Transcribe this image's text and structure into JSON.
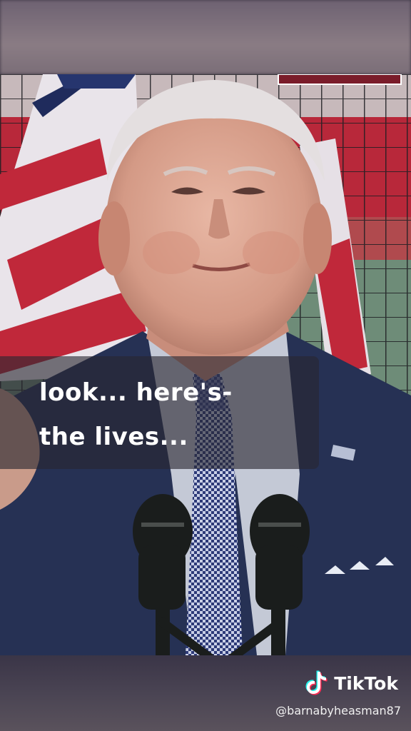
{
  "caption": {
    "line1": "look...  here's-",
    "line2": "the lives..."
  },
  "watermark": {
    "brand": "TikTok",
    "handle": "@barnabyheasman87"
  },
  "icons": [
    "tiktok-logo-icon"
  ],
  "colors": {
    "tiktok_cyan": "#25f4ee",
    "tiktok_red": "#fe2c55",
    "caption_bg": "#28262f"
  }
}
